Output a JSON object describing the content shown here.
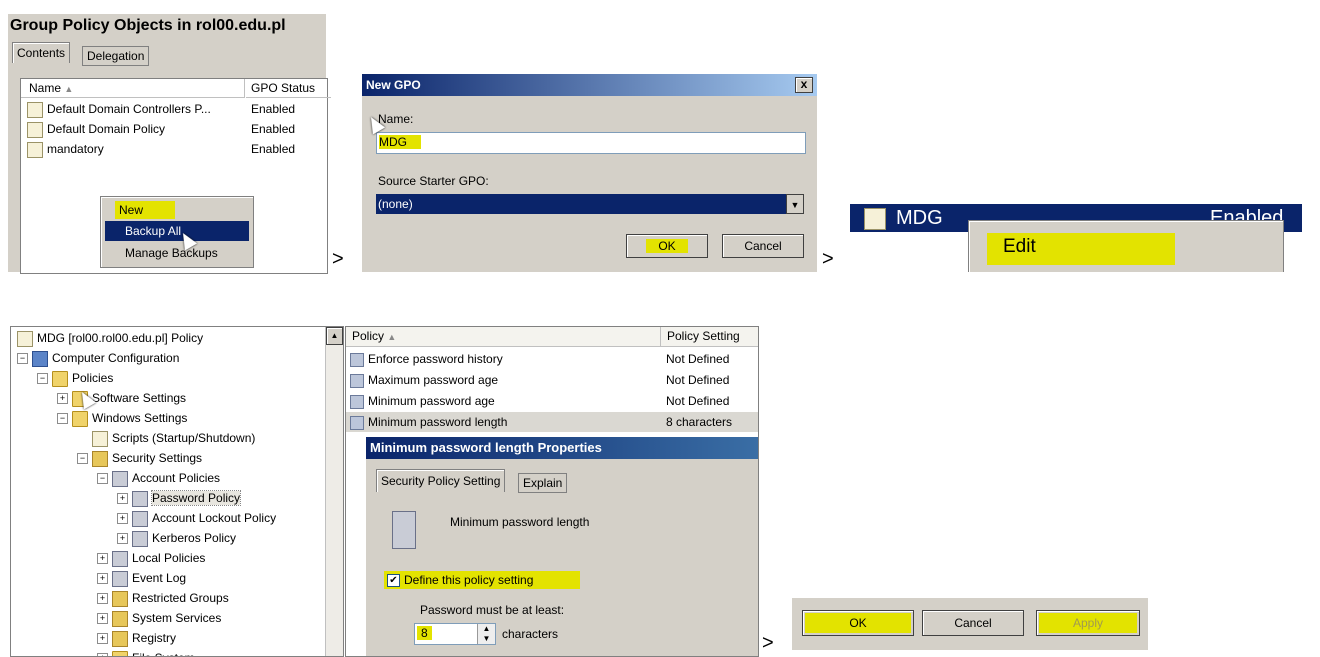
{
  "step1": {
    "title": "Group Policy Objects in rol00.edu.pl",
    "tabs": [
      "Contents",
      "Delegation"
    ],
    "columns": [
      "Name",
      "GPO Status"
    ],
    "rows": [
      {
        "name": "Default Domain Controllers P...",
        "status": "Enabled"
      },
      {
        "name": "Default Domain Policy",
        "status": "Enabled"
      },
      {
        "name": "mandatory",
        "status": "Enabled"
      }
    ],
    "context_menu": [
      "New",
      "Backup All",
      "Manage Backups"
    ]
  },
  "arrows": [
    ">",
    ">",
    ">"
  ],
  "step2": {
    "title": "New GPO",
    "close": "x",
    "name_label": "Name:",
    "name_value": "MDG",
    "source_label": "Source Starter GPO:",
    "source_value": "(none)",
    "ok": "OK",
    "cancel": "Cancel"
  },
  "step3": {
    "gpo_name": "MDG",
    "status": "Enabled",
    "menu_item": "Edit"
  },
  "step4": {
    "tree": [
      {
        "label": "MDG [rol00.rol00.edu.pl] Policy",
        "level": 0,
        "icon": "doc-icon",
        "pm": ""
      },
      {
        "label": "Computer Configuration",
        "level": 0,
        "icon": "computer-icon",
        "pm": "−"
      },
      {
        "label": "Policies",
        "level": 1,
        "icon": "folder-icon",
        "pm": "−"
      },
      {
        "label": "Software Settings",
        "level": 2,
        "icon": "folder-icon",
        "pm": "+"
      },
      {
        "label": "Windows Settings",
        "level": 2,
        "icon": "folder-icon",
        "pm": "−"
      },
      {
        "label": "Scripts (Startup/Shutdown)",
        "level": 3,
        "icon": "script-icon",
        "pm": ""
      },
      {
        "label": "Security Settings",
        "level": 3,
        "icon": "lock-icon",
        "pm": "−"
      },
      {
        "label": "Account Policies",
        "level": 4,
        "icon": "policy-icon",
        "pm": "−"
      },
      {
        "label": "Password Policy",
        "level": 5,
        "icon": "policy-icon",
        "pm": "+"
      },
      {
        "label": "Account Lockout Policy",
        "level": 5,
        "icon": "policy-icon",
        "pm": "+"
      },
      {
        "label": "Kerberos Policy",
        "level": 5,
        "icon": "policy-icon",
        "pm": "+"
      },
      {
        "label": "Local Policies",
        "level": 4,
        "icon": "policy-icon",
        "pm": "+"
      },
      {
        "label": "Event Log",
        "level": 4,
        "icon": "policy-icon",
        "pm": "+"
      },
      {
        "label": "Restricted Groups",
        "level": 4,
        "icon": "lock-icon",
        "pm": "+"
      },
      {
        "label": "System Services",
        "level": 4,
        "icon": "lock-icon",
        "pm": "+"
      },
      {
        "label": "Registry",
        "level": 4,
        "icon": "lock-icon",
        "pm": "+"
      },
      {
        "label": "File System",
        "level": 4,
        "icon": "folder-icon",
        "pm": "+"
      }
    ],
    "policy_columns": [
      "Policy",
      "Policy Setting"
    ],
    "policies": [
      {
        "name": "Enforce password history",
        "setting": "Not Defined"
      },
      {
        "name": "Maximum password age",
        "setting": "Not Defined"
      },
      {
        "name": "Minimum password age",
        "setting": "Not Defined"
      },
      {
        "name": "Minimum password length",
        "setting": "8 characters"
      }
    ]
  },
  "props": {
    "title": "Minimum password length Properties",
    "tabs": [
      "Security Policy Setting",
      "Explain"
    ],
    "heading": "Minimum password length",
    "checkbox_label": "Define this policy setting",
    "sub_label": "Password must be at least:",
    "value": "8",
    "unit": "characters"
  },
  "final_buttons": {
    "ok": "OK",
    "cancel": "Cancel",
    "apply": "Apply"
  }
}
